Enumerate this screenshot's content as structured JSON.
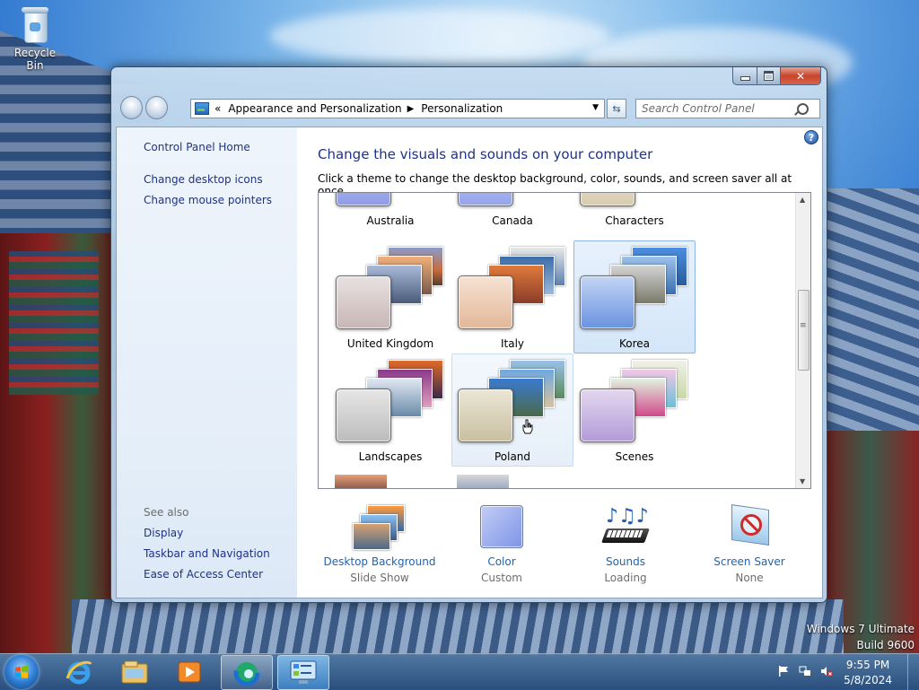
{
  "desktop": {
    "recycle_bin_label": "Recycle Bin"
  },
  "window": {
    "address": {
      "overflow": "«",
      "crumbs": [
        "Appearance and Personalization",
        "Personalization"
      ]
    },
    "search_placeholder": "Search Control Panel",
    "left_pane": {
      "home": "Control Panel Home",
      "links": [
        "Change desktop icons",
        "Change mouse pointers"
      ],
      "see_also_title": "See also",
      "see_also": [
        "Display",
        "Taskbar and Navigation",
        "Ease of Access Center"
      ]
    },
    "heading": "Change the visuals and sounds on your computer",
    "subheading": "Click a theme to change the desktop background, color, sounds, and screen saver all at once.",
    "themes": [
      "Australia",
      "Canada",
      "Characters",
      "United Kingdom",
      "Italy",
      "Korea",
      "Landscapes",
      "Poland",
      "Scenes"
    ],
    "selected_theme": "Korea",
    "hovered_theme": "Poland",
    "bottom": [
      {
        "label": "Desktop Background",
        "value": "Slide Show",
        "icon": "desktop-background-icon"
      },
      {
        "label": "Color",
        "value": "Custom",
        "icon": "color-icon"
      },
      {
        "label": "Sounds",
        "value": "Loading",
        "icon": "sounds-icon"
      },
      {
        "label": "Screen Saver",
        "value": "None",
        "icon": "screen-saver-icon"
      }
    ]
  },
  "watermark": {
    "line1": "Windows 7 Ultimate",
    "line2": "Build 9600"
  },
  "taskbar": {
    "apps": [
      "internet-explorer-icon",
      "file-explorer-icon",
      "media-player-icon",
      "edge-icon",
      "control-panel-icon"
    ],
    "time": "9:55 PM",
    "date": "5/8/2024"
  },
  "colors": {
    "link": "#1e3287",
    "tile_link": "#1e64b4",
    "muted": "#6d6d6d",
    "selected_bg": "#d4e6fa"
  }
}
